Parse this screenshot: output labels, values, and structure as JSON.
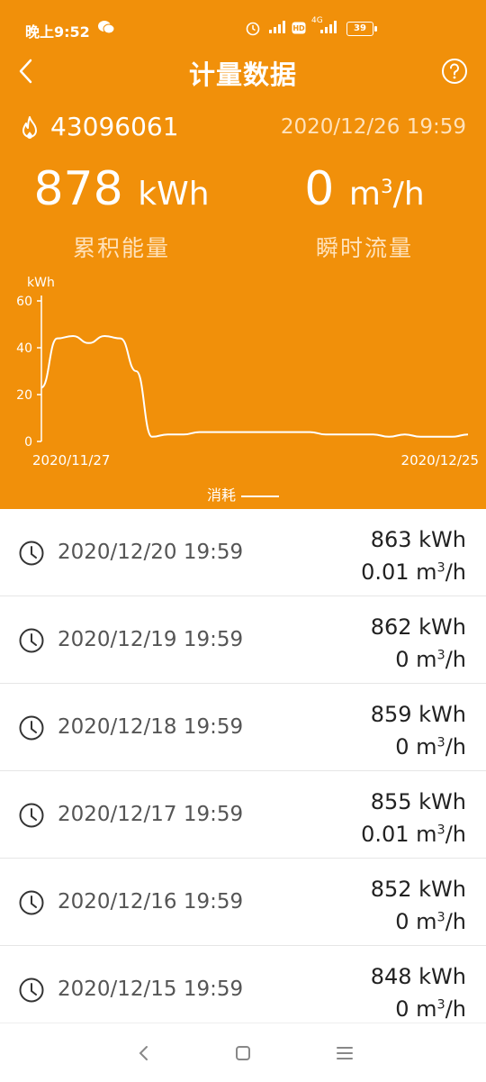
{
  "status_bar": {
    "time": "晚上9:52",
    "network": "4G",
    "battery": "39"
  },
  "header": {
    "title": "计量数据"
  },
  "device": {
    "id": "43096061",
    "timestamp": "2020/12/26 19:59"
  },
  "summary": {
    "energy": {
      "value": "878",
      "unit": "kWh",
      "label": "累积能量"
    },
    "flow": {
      "value": "0",
      "unit_base": "m",
      "unit_exp": "3",
      "unit_tail": "/h",
      "label": "瞬时流量"
    }
  },
  "chart_data": {
    "type": "line",
    "ylabel": "kWh",
    "ylim": [
      0,
      60
    ],
    "yticks": [
      "0",
      "20",
      "40",
      "60"
    ],
    "x_start_label": "2020/11/27",
    "x_end_label": "2020/12/25",
    "series": [
      {
        "name": "消耗",
        "color": "#ffffff",
        "values": [
          23,
          44,
          45,
          42,
          45,
          44,
          30,
          2,
          3,
          3,
          4,
          4,
          4,
          4,
          4,
          4,
          4,
          4,
          3,
          3,
          3,
          3,
          2,
          3,
          2,
          2,
          2,
          3
        ]
      }
    ]
  },
  "legend": {
    "label": "消耗"
  },
  "records": [
    {
      "date": "2020/12/20 19:59",
      "energy": "863 kWh",
      "flow_value": "0.01",
      "flow_unit_base": "m",
      "flow_unit_exp": "3",
      "flow_unit_tail": "/h"
    },
    {
      "date": "2020/12/19 19:59",
      "energy": "862 kWh",
      "flow_value": "0",
      "flow_unit_base": "m",
      "flow_unit_exp": "3",
      "flow_unit_tail": "/h"
    },
    {
      "date": "2020/12/18 19:59",
      "energy": "859 kWh",
      "flow_value": "0",
      "flow_unit_base": "m",
      "flow_unit_exp": "3",
      "flow_unit_tail": "/h"
    },
    {
      "date": "2020/12/17 19:59",
      "energy": "855 kWh",
      "flow_value": "0.01",
      "flow_unit_base": "m",
      "flow_unit_exp": "3",
      "flow_unit_tail": "/h"
    },
    {
      "date": "2020/12/16 19:59",
      "energy": "852 kWh",
      "flow_value": "0",
      "flow_unit_base": "m",
      "flow_unit_exp": "3",
      "flow_unit_tail": "/h"
    },
    {
      "date": "2020/12/15 19:59",
      "energy": "848 kWh",
      "flow_value": "0",
      "flow_unit_base": "m",
      "flow_unit_exp": "3",
      "flow_unit_tail": "/h"
    }
  ],
  "colors": {
    "accent": "#f1900a",
    "muted_text": "#ffe2bb"
  }
}
